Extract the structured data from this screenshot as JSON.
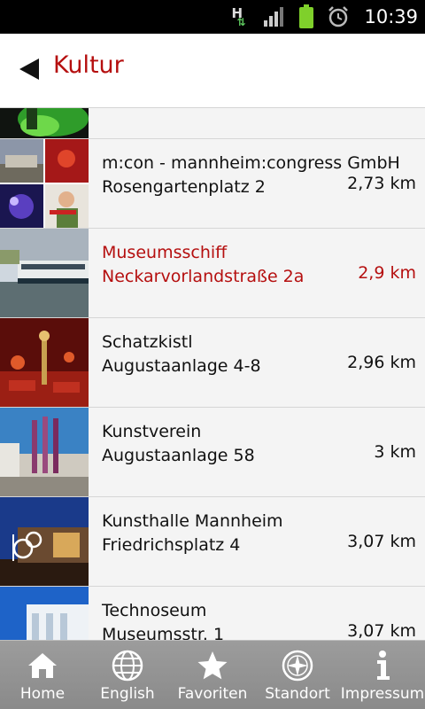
{
  "statusbar": {
    "time": "10:39",
    "network_label": "H"
  },
  "header": {
    "title": "Kultur"
  },
  "list": {
    "items": [
      {
        "name": "",
        "address": "",
        "distance": ""
      },
      {
        "name": "m:con - mannheim:congress GmbH",
        "address": "Rosengartenplatz 2",
        "distance": "2,73 km"
      },
      {
        "name": "Museumsschiff",
        "address": "Neckarvorlandstraße 2a",
        "distance": "2,9 km"
      },
      {
        "name": "Schatzkistl",
        "address": "Augustaanlage 4-8",
        "distance": "2,96 km"
      },
      {
        "name": "Kunstverein",
        "address": "Augustaanlage 58",
        "distance": "3 km"
      },
      {
        "name": "Kunsthalle Mannheim",
        "address": "Friedrichsplatz 4",
        "distance": "3,07 km"
      },
      {
        "name": "Technoseum",
        "address": "Museumsstr. 1",
        "distance": "3,07 km"
      }
    ]
  },
  "tabs": [
    {
      "label": "Home",
      "icon": "home-icon"
    },
    {
      "label": "English",
      "icon": "globe-icon"
    },
    {
      "label": "Favoriten",
      "icon": "star-icon"
    },
    {
      "label": "Standort",
      "icon": "compass-icon"
    },
    {
      "label": "Impressum",
      "icon": "info-icon"
    }
  ],
  "colors": {
    "accent": "#b50f0f",
    "row_bg": "#f4f4f4",
    "tabbar": "#929292"
  }
}
